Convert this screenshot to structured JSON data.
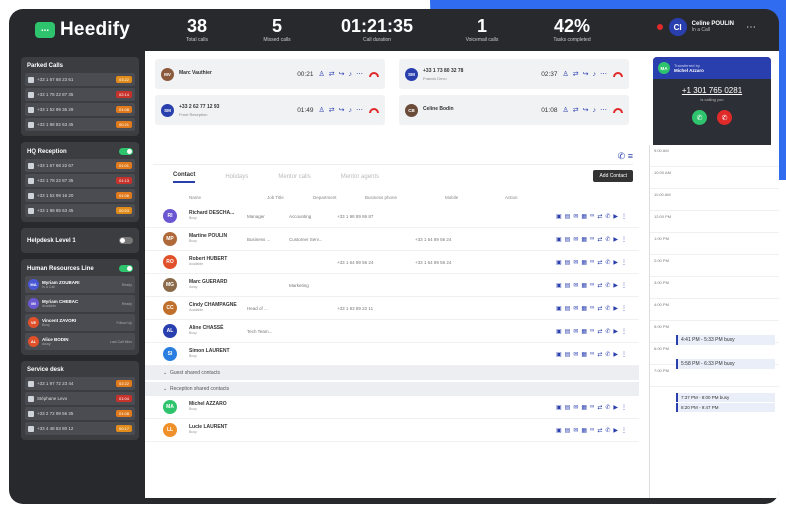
{
  "app": {
    "name": "Heedify",
    "logo_glyph": "..."
  },
  "stats": [
    {
      "value": "38",
      "label": "Total calls"
    },
    {
      "value": "5",
      "label": "Missed calls"
    },
    {
      "value": "01:21:35",
      "label": "Call duration"
    },
    {
      "value": "1",
      "label": "Voicemail calls"
    },
    {
      "value": "42%",
      "label": "Tasks completed"
    }
  ],
  "user": {
    "initials": "CI",
    "name": "Celine POULIN",
    "status": "In a Call"
  },
  "parked": {
    "title": "Parked Calls",
    "rows": [
      {
        "num": "+33 1 67 68 23 61",
        "tag": "03:22"
      },
      {
        "num": "+33 1 78 22 87 35",
        "tag": "02:14"
      },
      {
        "num": "+33 1 52 99 36 29",
        "tag": "01:08"
      },
      {
        "num": "+33 1 98 82 63 45",
        "tag": "00:21"
      }
    ]
  },
  "hq": {
    "title": "HQ Reception",
    "rows": [
      {
        "num": "+33 1 67 68 22 67",
        "tag": "01:01"
      },
      {
        "num": "+33 1 78 22 87 35",
        "tag": "01:13"
      },
      {
        "num": "+33 1 52 99 16 20",
        "tag": "01:06"
      },
      {
        "num": "+33 1 98 85 63 45",
        "tag": "00:53"
      }
    ]
  },
  "helpdesk": {
    "title": "Helpdesk Level 1"
  },
  "hr": {
    "title": "Human Resources Line",
    "rows": [
      {
        "initials": "MA",
        "color": "#4a58d6",
        "name": "Myriam ZOUBARI",
        "status": "In a Call",
        "right": "Ready"
      },
      {
        "initials": "MI",
        "color": "#6b57d1",
        "name": "Myriam CHEBAC",
        "status": "Available",
        "right": "Ready"
      },
      {
        "initials": "VE",
        "color": "#e0502a",
        "name": "Vincent ZAVORI",
        "status": "Busy",
        "right": "Follow Up"
      },
      {
        "initials": "AL",
        "color": "#e0502a",
        "name": "Alice BODIN",
        "status": "Away",
        "right": "Last Call Mins"
      }
    ]
  },
  "service": {
    "title": "Service desk",
    "rows": [
      {
        "num": "+33 1 97 72 23 44",
        "tag": "02:22"
      },
      {
        "num": "Stéphane Levo",
        "tag": "01:04"
      },
      {
        "num": "+33 2 72 99 56 35",
        "tag": "01:08"
      },
      {
        "num": "+33 4 48 83 80 12",
        "tag": "00:17"
      }
    ]
  },
  "calls": [
    {
      "initials": "MV",
      "color": "#8b5a3c",
      "name": "Marc Vauthier",
      "sub": "",
      "time": "00:21"
    },
    {
      "initials": "SM",
      "color": "#2a3fae",
      "name": "+33 1 73 80 32 78",
      "sub": "Francis Devo",
      "time": "02:37"
    },
    {
      "initials": "SM",
      "color": "#2a3fae",
      "name": "+33 2 62 77 12 93",
      "sub": "Front Reception",
      "time": "01:49"
    },
    {
      "initials": "CB",
      "color": "#6a4b3a",
      "name": "Celine Bodin",
      "sub": "",
      "time": "01:08"
    }
  ],
  "transfer": {
    "initials": "MA",
    "label": "Transferred by",
    "by": "Michel Azzaro",
    "number": "+1 301 765 0281",
    "sub": "is calling you"
  },
  "tabs": [
    "Contact",
    "Holidays",
    "Mentor calls",
    "Mentor agents"
  ],
  "add_contact": "Add Contact",
  "columns": [
    "Name",
    "Job Title",
    "Department",
    "Business phone",
    "Mobile",
    "Action"
  ],
  "contacts": [
    {
      "initials": "RI",
      "color": "#6b57d1",
      "name": "Richard DESCHA...",
      "status": "Busy",
      "job": "Manager",
      "dept": "Accounting",
      "bphone": "+33 1 98 89 86 87",
      "mobile": ""
    },
    {
      "initials": "MP",
      "color": "#b06a3a",
      "name": "Martine POULIN",
      "status": "Busy",
      "job": "Business ...",
      "dept": "Customer Serv...",
      "bphone": "",
      "mobile": "+33 1 64 89 56 24"
    },
    {
      "initials": "RO",
      "color": "#e0502a",
      "name": "Robert HUBERT",
      "status": "Available",
      "job": "",
      "dept": "",
      "bphone": "+33 1 64 89 56 24",
      "mobile": "+33 1 64 89 56 24"
    },
    {
      "initials": "MG",
      "color": "#8b6a4a",
      "name": "Marc GUERARD",
      "status": "Away",
      "job": "",
      "dept": "Marketing",
      "bphone": "",
      "mobile": ""
    },
    {
      "initials": "CC",
      "color": "#c0702a",
      "name": "Cindy CHAMPAGNE",
      "status": "Available",
      "job": "Head of ...",
      "dept": "",
      "bphone": "+33 1 83 89 22 11",
      "mobile": ""
    },
    {
      "initials": "AL",
      "color": "#2a3fae",
      "name": "Aline CHASSÉ",
      "status": "Busy",
      "job": "Tech Team...",
      "dept": "",
      "bphone": "",
      "mobile": ""
    },
    {
      "initials": "SI",
      "color": "#2a7ee0",
      "name": "Simon LAURENT",
      "status": "Busy",
      "job": "",
      "dept": "",
      "bphone": "",
      "mobile": ""
    }
  ],
  "groups": [
    "Guest shared contacts",
    "Reception shared contacts"
  ],
  "shared": [
    {
      "initials": "MA",
      "color": "#2ec46d",
      "name": "Michel AZZARO",
      "status": "Busy"
    },
    {
      "initials": "LL",
      "color": "#f0902a",
      "name": "Lucie LAURENT",
      "status": "Busy"
    }
  ],
  "calendar": {
    "times": [
      "9:00 AM",
      "10:00 AM",
      "11:00 AM",
      "12:00 PM",
      "1:00 PM",
      "2:00 PM",
      "3:00 PM",
      "4:00 PM",
      "5:00 PM",
      "6:00 PM",
      "7:00 PM"
    ],
    "events": [
      "4:41 PM - 5:33 PM busy",
      "5:58 PM - 6:33 PM busy",
      "7:37 PM - 8:00 PM busy",
      "8:20 PM - 9:47 PM"
    ]
  }
}
